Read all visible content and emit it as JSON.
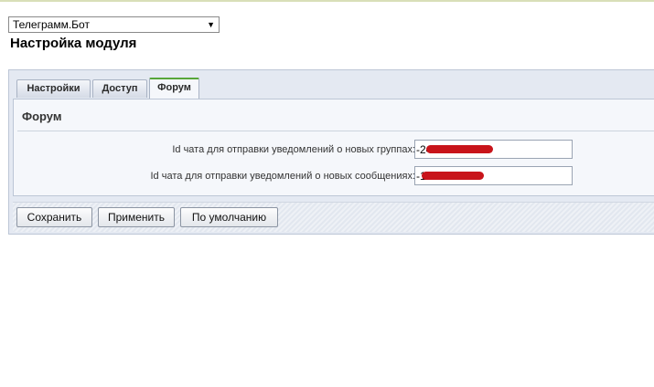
{
  "module_select": {
    "selected": "Телеграмм.Бот"
  },
  "page_title": "Настройка модуля",
  "tabs": [
    {
      "label": "Настройки",
      "active": false
    },
    {
      "label": "Доступ",
      "active": false
    },
    {
      "label": "Форум",
      "active": true
    }
  ],
  "section": {
    "title": "Форум",
    "fields": [
      {
        "label": "Id чата для отправки уведомлений о новых группах:",
        "value": "-24"
      },
      {
        "label": "Id чата для отправки уведомлений о новых сообщениях:",
        "value": "-1"
      }
    ]
  },
  "buttons": {
    "save": "Сохранить",
    "apply": "Применить",
    "default": "По умолчанию"
  },
  "colors": {
    "active_tab_accent": "#57a639",
    "panel_bg": "#e4e9f2",
    "redaction": "#c8141a"
  }
}
